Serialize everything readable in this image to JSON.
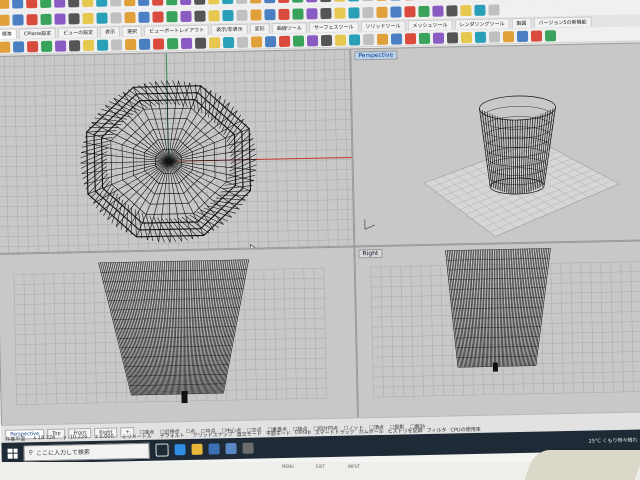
{
  "menu_tabs": [
    "標準",
    "CPlane設定",
    "ビューの設定",
    "表示",
    "選択",
    "ビューポートレイアウト",
    "表示/非表示",
    "変形",
    "曲線ツール",
    "サーフェスツール",
    "ソリッドツール",
    "メッシュツール",
    "レンダリングツール",
    "製図",
    "バージョン5の新機能"
  ],
  "viewports": {
    "top_right_label": "Perspective",
    "bottom_right_label": "Right"
  },
  "statusbar": {
    "viewport_tabs": [
      "Perspective",
      "Top",
      "Front",
      "Right"
    ],
    "add_tab": "+",
    "osnaps": [
      "端点",
      "近接点",
      "点",
      "中点",
      "中心点",
      "交点",
      "垂直点",
      "接点",
      "四分円点",
      "ノット",
      "頂点",
      "投影",
      "無効"
    ],
    "plane": "作業平面",
    "x": "x 18.226",
    "y": "y -10.224",
    "z": "z 0.000",
    "units": "ミリメートル",
    "layer": "デフォルト",
    "modes": [
      "グリッドスナップ",
      "直交モード",
      "平面モード",
      "Osnap",
      "スマートトラック",
      "ガムボール",
      "ヒストリを記録",
      "フィルタ",
      "CPUの使用率"
    ]
  },
  "taskbar": {
    "search_placeholder": "ここに入力して検索",
    "weather": "25°C くもり時々晴れ"
  },
  "bezel_labels": [
    "MENU",
    "EXIT",
    "INPUT"
  ],
  "colors": {
    "viewport_bg": "#c8c8c8",
    "grid": "#a9a9a9",
    "x_axis": "#c0392b",
    "y_axis": "#2e8b57",
    "wire": "#111111",
    "active_label": "#bcd3ec",
    "taskbar": "#1e2a36"
  }
}
